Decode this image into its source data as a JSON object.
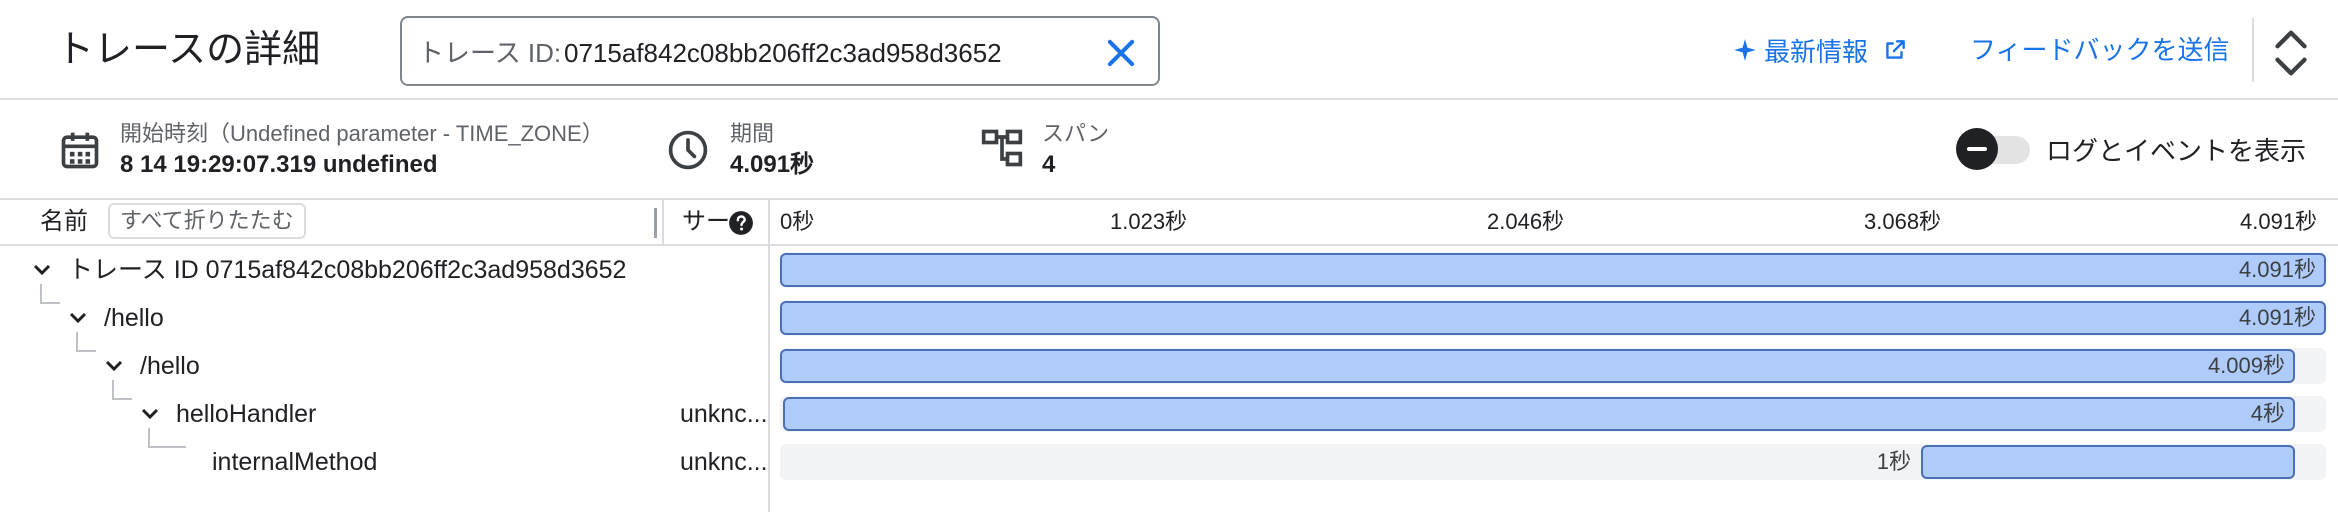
{
  "header": {
    "title": "トレースの詳細",
    "trace_input_label": "トレース ID:",
    "trace_input_value": "0715af842c08bb206ff2c3ad958d3652",
    "news_label": "最新情報",
    "feedback_label": "フィードバックを送信"
  },
  "info": {
    "start_label": "開始時刻（Undefined parameter - TIME_ZONE）",
    "start_value": "8 14 19:29:07.319 undefined",
    "duration_label": "期間",
    "duration_value": "4.091秒",
    "spans_label": "スパン",
    "spans_value": "4",
    "toggle_label": "ログとイベントを表示",
    "toggle_on": true
  },
  "table": {
    "name_header": "名前",
    "collapse_all_label": "すべて折りたたむ",
    "service_header": "サー",
    "timeline_ticks": [
      "0秒",
      "1.023秒",
      "2.046秒",
      "3.068秒",
      "4.091秒"
    ],
    "rows": [
      {
        "name": "トレース ID 0715af842c08bb206ff2c3ad958d3652",
        "service": "",
        "duration_label": "4.091秒",
        "start_fraction": 0.0,
        "duration_fraction": 1.0
      },
      {
        "name": "/hello",
        "service": "",
        "duration_label": "4.091秒",
        "start_fraction": 0.0,
        "duration_fraction": 1.0
      },
      {
        "name": "/hello",
        "service": "",
        "duration_label": "4.009秒",
        "start_fraction": 0.0,
        "duration_fraction": 0.98
      },
      {
        "name": "helloHandler",
        "service": "unknc...",
        "duration_label": "4秒",
        "start_fraction": 0.002,
        "duration_fraction": 0.978
      },
      {
        "name": "internalMethod",
        "service": "unknc...",
        "duration_label": "1秒",
        "start_fraction": 0.738,
        "duration_fraction": 0.242
      }
    ]
  },
  "colors": {
    "accent": "#1a73e8",
    "bar_fill": "#aecbfa",
    "bar_border": "#4a6fb5"
  },
  "icons": [
    "sparkle-icon",
    "external-link-icon",
    "close-icon",
    "unfold-icon",
    "calendar-icon",
    "clock-icon",
    "span-tree-icon",
    "help-icon",
    "chevron-down-icon"
  ]
}
